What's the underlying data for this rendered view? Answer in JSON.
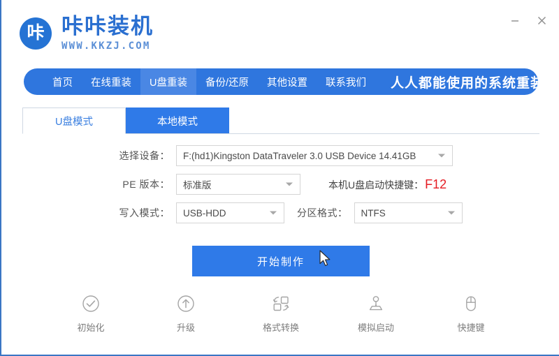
{
  "window": {
    "logo_char": "咔",
    "brand_title": "咔咔装机",
    "brand_url": "WWW.KKZJ.COM",
    "minimize_label": "—",
    "close_label": "×",
    "accent_color": "#2f76de",
    "nav_active_color": "#4a87e4",
    "danger_color": "#e51c23"
  },
  "nav": {
    "items": [
      {
        "label": "首页",
        "active": false
      },
      {
        "label": "在线重装",
        "active": false
      },
      {
        "label": "U盘重装",
        "active": true
      },
      {
        "label": "备份/还原",
        "active": false
      },
      {
        "label": "其他设置",
        "active": false
      },
      {
        "label": "联系我们",
        "active": false
      }
    ],
    "slogan": "人人都能使用的系统重装工具"
  },
  "tabs": [
    {
      "label": "U盘模式",
      "active": true
    },
    {
      "label": "本地模式",
      "active": false
    }
  ],
  "form": {
    "device": {
      "label": "选择设备：",
      "value": "F:(hd1)Kingston DataTraveler 3.0 USB Device 14.41GB"
    },
    "pe_version": {
      "label": "PE 版本：",
      "value": "标准版"
    },
    "hotkey": {
      "label": "本机U盘启动快捷键：",
      "key": "F12"
    },
    "write_mode": {
      "label": "写入模式：",
      "value": "USB-HDD"
    },
    "partition_format": {
      "label": "分区格式：",
      "value": "NTFS"
    }
  },
  "action": {
    "start_label": "开始制作"
  },
  "tools": [
    {
      "icon": "check-circle-icon",
      "label": "初始化"
    },
    {
      "icon": "upgrade-arrow-circle-icon",
      "label": "升级"
    },
    {
      "icon": "format-convert-icon",
      "label": "格式转换"
    },
    {
      "icon": "joystick-icon",
      "label": "模拟启动"
    },
    {
      "icon": "mouse-icon",
      "label": "快捷键"
    }
  ]
}
